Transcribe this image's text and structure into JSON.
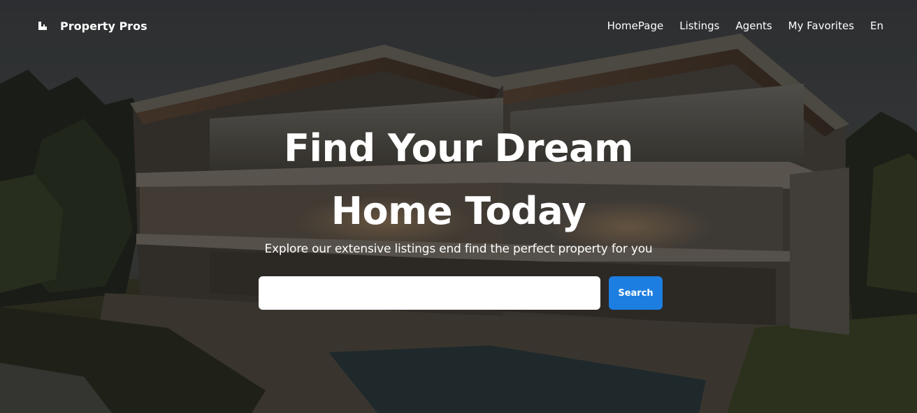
{
  "navbar": {
    "brand": "Property Pros",
    "links": [
      "HomePage",
      "Listings",
      "Agents",
      "My Favorites",
      "En"
    ]
  },
  "hero": {
    "title_line1": "Find Your Dream",
    "title_line2": "Home Today",
    "subtitle": "Explore our extensive listings end find the perfect property for you",
    "search": {
      "placeholder": "",
      "value": "",
      "button_label": "Search"
    }
  },
  "colors": {
    "accent": "#1c7ee0",
    "text": "#ffffff",
    "input_bg": "#ffffff"
  },
  "icons": {
    "brand_logo": "building-logo-icon"
  }
}
